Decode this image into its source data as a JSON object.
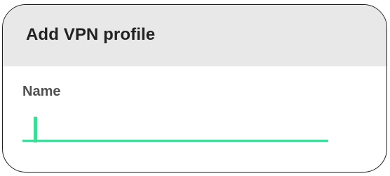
{
  "dialog": {
    "title": "Add VPN profile"
  },
  "form": {
    "name_label": "Name",
    "name_value": ""
  },
  "colors": {
    "accent": "#3ddc97",
    "header_bg": "#e8e8e8",
    "title_text": "#222222",
    "label_text": "#4f4f4f"
  }
}
